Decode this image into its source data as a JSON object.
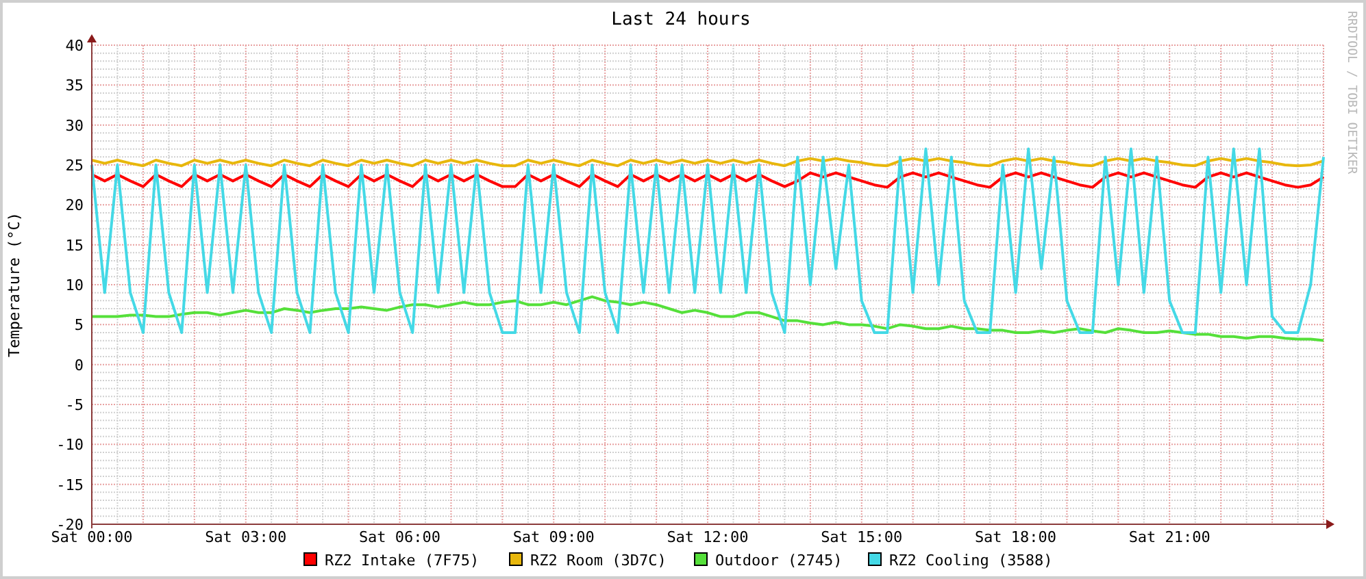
{
  "chart_data": {
    "type": "line",
    "title": "Last 24 hours",
    "ylabel": "Temperature (°C)",
    "ylim": [
      -20,
      40
    ],
    "grid": true,
    "legend": "bottom",
    "categories": [
      "Sat 00:00",
      null,
      null,
      null,
      null,
      null,
      null,
      null,
      null,
      null,
      null,
      null,
      "Sat 03:00",
      null,
      null,
      null,
      null,
      null,
      null,
      null,
      null,
      null,
      null,
      null,
      "Sat 06:00",
      null,
      null,
      null,
      null,
      null,
      null,
      null,
      null,
      null,
      null,
      null,
      "Sat 09:00",
      null,
      null,
      null,
      null,
      null,
      null,
      null,
      null,
      null,
      null,
      null,
      "Sat 12:00",
      null,
      null,
      null,
      null,
      null,
      null,
      null,
      null,
      null,
      null,
      null,
      "Sat 15:00",
      null,
      null,
      null,
      null,
      null,
      null,
      null,
      null,
      null,
      null,
      null,
      "Sat 18:00",
      null,
      null,
      null,
      null,
      null,
      null,
      null,
      null,
      null,
      null,
      null,
      "Sat 21:00",
      null,
      null,
      null,
      null,
      null,
      null,
      null,
      null,
      null,
      null,
      null,
      null
    ],
    "yticks": [
      -20,
      -15,
      -10,
      -5,
      0,
      5,
      10,
      15,
      20,
      25,
      30,
      35,
      40
    ],
    "series": [
      {
        "name": "RZ2 Intake (7F75)",
        "color": "#ff0000",
        "values": [
          23.8,
          23,
          23.8,
          23,
          22.3,
          23.8,
          23,
          22.3,
          23.8,
          23,
          23.8,
          23,
          23.8,
          23,
          22.3,
          23.8,
          23,
          22.3,
          23.8,
          23,
          22.3,
          23.8,
          23,
          23.8,
          23,
          22.3,
          23.8,
          23,
          23.8,
          23,
          23.8,
          23,
          22.3,
          22.3,
          23.8,
          23,
          23.8,
          23,
          22.3,
          23.8,
          23,
          22.3,
          23.8,
          23,
          23.8,
          23,
          23.8,
          23,
          23.8,
          23,
          23.8,
          23,
          23.8,
          23,
          22.3,
          23,
          24,
          23.5,
          24,
          23.5,
          23,
          22.5,
          22.2,
          23.5,
          24,
          23.5,
          24,
          23.5,
          23,
          22.5,
          22.2,
          23.5,
          24,
          23.5,
          24,
          23.5,
          23,
          22.5,
          22.2,
          23.5,
          24,
          23.5,
          24,
          23.5,
          23,
          22.5,
          22.2,
          23.5,
          24,
          23.5,
          24,
          23.5,
          23,
          22.5,
          22.2,
          22.5,
          23.5
        ]
      },
      {
        "name": "RZ2 Room (3D7C)",
        "color": "#e8b70c",
        "values": [
          25.6,
          25.2,
          25.6,
          25.2,
          24.9,
          25.6,
          25.2,
          24.9,
          25.6,
          25.2,
          25.6,
          25.2,
          25.6,
          25.2,
          24.9,
          25.6,
          25.2,
          24.9,
          25.6,
          25.2,
          24.9,
          25.6,
          25.2,
          25.6,
          25.2,
          24.9,
          25.6,
          25.2,
          25.6,
          25.2,
          25.6,
          25.2,
          24.9,
          24.9,
          25.6,
          25.2,
          25.6,
          25.2,
          24.9,
          25.6,
          25.2,
          24.9,
          25.6,
          25.2,
          25.6,
          25.2,
          25.6,
          25.2,
          25.6,
          25.2,
          25.6,
          25.2,
          25.6,
          25.2,
          24.9,
          25.5,
          25.8,
          25.5,
          25.8,
          25.5,
          25.3,
          25,
          24.9,
          25.5,
          25.8,
          25.5,
          25.8,
          25.5,
          25.3,
          25,
          24.9,
          25.5,
          25.8,
          25.5,
          25.8,
          25.5,
          25.3,
          25,
          24.9,
          25.5,
          25.8,
          25.5,
          25.8,
          25.5,
          25.3,
          25,
          24.9,
          25.5,
          25.8,
          25.5,
          25.8,
          25.5,
          25.3,
          25,
          24.9,
          25,
          25.5
        ]
      },
      {
        "name": "Outdoor (2745)",
        "color": "#55e03a",
        "values": [
          6,
          6,
          6,
          6.2,
          6.2,
          6,
          6,
          6.3,
          6.5,
          6.5,
          6.2,
          6.5,
          6.8,
          6.5,
          6.5,
          7,
          6.8,
          6.5,
          6.8,
          7,
          7,
          7.2,
          7,
          6.8,
          7.2,
          7.5,
          7.5,
          7.2,
          7.5,
          7.8,
          7.5,
          7.5,
          7.8,
          8,
          7.5,
          7.5,
          7.8,
          7.5,
          8,
          8.5,
          8,
          7.8,
          7.5,
          7.8,
          7.5,
          7,
          6.5,
          6.8,
          6.5,
          6,
          6,
          6.5,
          6.5,
          6,
          5.5,
          5.5,
          5.2,
          5,
          5.3,
          5,
          5,
          4.8,
          4.5,
          5,
          4.8,
          4.5,
          4.5,
          4.8,
          4.5,
          4.5,
          4.3,
          4.3,
          4,
          4,
          4.2,
          4,
          4.3,
          4.5,
          4.2,
          4,
          4.5,
          4.3,
          4,
          4,
          4.2,
          4,
          3.8,
          3.8,
          3.5,
          3.5,
          3.3,
          3.5,
          3.5,
          3.3,
          3.2,
          3.2,
          3
        ]
      },
      {
        "name": "RZ2 Cooling (3588)",
        "color": "#44d9e6",
        "values": [
          25,
          9,
          25,
          9,
          4,
          25,
          9,
          4,
          25,
          9,
          25,
          9,
          25,
          9,
          4,
          25,
          9,
          4,
          25,
          9,
          4,
          25,
          9,
          25,
          9,
          4,
          25,
          9,
          25,
          9,
          25,
          9,
          4,
          4,
          25,
          9,
          25,
          9,
          4,
          25,
          9,
          4,
          25,
          9,
          25,
          9,
          25,
          9,
          25,
          9,
          25,
          9,
          25,
          9,
          4,
          26,
          10,
          26,
          12,
          25,
          8,
          4,
          4,
          26,
          9,
          27,
          10,
          26,
          8,
          4,
          4,
          25,
          9,
          27,
          12,
          26,
          8,
          4,
          4,
          26,
          10,
          27,
          9,
          26,
          8,
          4,
          4,
          26,
          9,
          27,
          10,
          27,
          6,
          4,
          4,
          10,
          26
        ]
      }
    ]
  },
  "side_text": "RRDTOOL / TOBI OETIKER"
}
